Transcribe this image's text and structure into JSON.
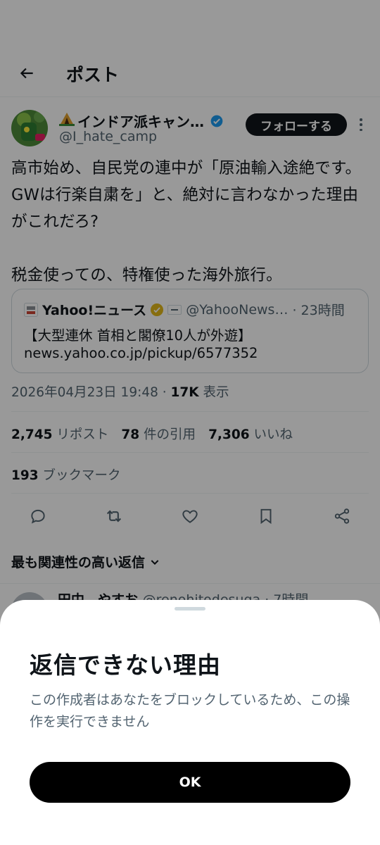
{
  "header": {
    "title": "ポスト"
  },
  "author": {
    "name": "インドア派キャン…",
    "handle": "@I_hate_camp",
    "follow_label": "フォローする"
  },
  "post": {
    "text": "高市始め、自民党の連中が「原油輸入途絶です。GWは行楽自粛を」と、絶対に言わなかった理由がこれだろ?\n\n税金使っての、特権使った海外旅行。"
  },
  "quote": {
    "name": "Yahoo!ニュース",
    "handle": "@YahooNews…",
    "time": "· 23時間",
    "title": "【大型連休 首相と閣僚10人が外遊】",
    "url": "news.yahoo.co.jp/pickup/6577352"
  },
  "meta": {
    "datetime": "2026年04月23日 19:48 · ",
    "views_count": "17K",
    "views_label": " 表示"
  },
  "stats": {
    "reposts_count": "2,745",
    "reposts_label": " リポスト",
    "quotes_count": "78",
    "quotes_label": " 件の引用",
    "likes_count": "7,306",
    "likes_label": " いいね",
    "bookmarks_count": "193",
    "bookmarks_label": " ブックマーク"
  },
  "actions": [
    "reply-icon",
    "repost-icon",
    "like-icon",
    "bookmark-icon",
    "share-icon"
  ],
  "sort": {
    "label": "最も関連性の高い返信"
  },
  "reply_preview": {
    "name": "田中　やすお",
    "handle": "@renohitodesuga · 7時間"
  },
  "sheet": {
    "title": "返信できない理由",
    "body": "この作成者はあなたをブロックしているため、この操作を実行できません",
    "ok_label": "OK"
  },
  "colors": {
    "text": "#0f1419",
    "secondary": "#536471",
    "border": "#cfd9de",
    "verified": "#1d9bf0",
    "affiliate_gold": "#e2b719",
    "overlay": "rgba(0,0,0,0.4)"
  }
}
